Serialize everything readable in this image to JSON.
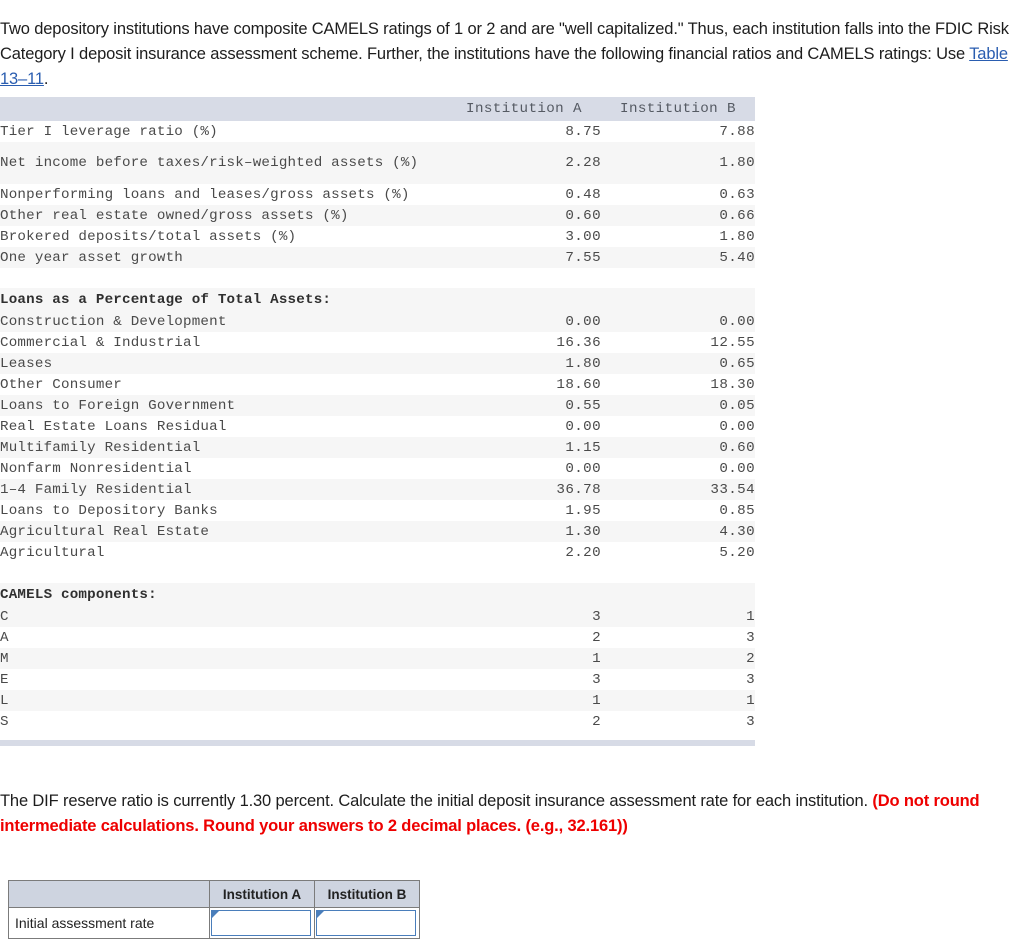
{
  "intro": {
    "part1": "Two depository institutions have composite CAMELS ratings of 1 or 2 and are \"well capitalized.\" Thus, each institution falls into the FDIC Risk Category I deposit insurance assessment scheme. Further, the institutions have the following financial ratios and CAMELS ratings: Use ",
    "link_text": "Table 13–11",
    "part2": "."
  },
  "table": {
    "headers": [
      "",
      "Institution A",
      "Institution B"
    ],
    "rows": [
      {
        "label": "Tier I leverage ratio (%)",
        "a": "8.75",
        "b": "7.88",
        "type": "row"
      },
      {
        "label": "Net income before taxes/risk–weighted assets (%)",
        "a": "2.28",
        "b": "1.80",
        "type": "row-tall"
      },
      {
        "label": "Nonperforming loans and leases/gross assets (%)",
        "a": "0.48",
        "b": "0.63",
        "type": "row"
      },
      {
        "label": "Other real estate owned/gross assets (%)",
        "a": "0.60",
        "b": "0.66",
        "type": "row"
      },
      {
        "label": "Brokered deposits/total assets (%)",
        "a": "3.00",
        "b": "1.80",
        "type": "row"
      },
      {
        "label": "One year asset growth",
        "a": "7.55",
        "b": "5.40",
        "type": "row"
      },
      {
        "label": "",
        "a": "",
        "b": "",
        "type": "spacer"
      },
      {
        "label": "Loans as a Percentage of Total Assets:",
        "a": "",
        "b": "",
        "type": "section"
      },
      {
        "label": "Construction & Development",
        "a": "0.00",
        "b": "0.00",
        "type": "row"
      },
      {
        "label": "Commercial & Industrial",
        "a": "16.36",
        "b": "12.55",
        "type": "row"
      },
      {
        "label": "Leases",
        "a": "1.80",
        "b": "0.65",
        "type": "row"
      },
      {
        "label": "Other Consumer",
        "a": "18.60",
        "b": "18.30",
        "type": "row"
      },
      {
        "label": "Loans to Foreign Government",
        "a": "0.55",
        "b": "0.05",
        "type": "row"
      },
      {
        "label": "Real Estate Loans Residual",
        "a": "0.00",
        "b": "0.00",
        "type": "row"
      },
      {
        "label": "Multifamily Residential",
        "a": "1.15",
        "b": "0.60",
        "type": "row"
      },
      {
        "label": "Nonfarm Nonresidential",
        "a": "0.00",
        "b": "0.00",
        "type": "row"
      },
      {
        "label": "1–4 Family Residential",
        "a": "36.78",
        "b": "33.54",
        "type": "row"
      },
      {
        "label": "Loans to Depository Banks",
        "a": "1.95",
        "b": "0.85",
        "type": "row"
      },
      {
        "label": "Agricultural Real Estate",
        "a": "1.30",
        "b": "4.30",
        "type": "row"
      },
      {
        "label": "Agricultural",
        "a": "2.20",
        "b": "5.20",
        "type": "row"
      },
      {
        "label": "",
        "a": "",
        "b": "",
        "type": "spacer"
      },
      {
        "label": "CAMELS components:",
        "a": "",
        "b": "",
        "type": "section"
      },
      {
        "label": "C",
        "a": "3",
        "b": "1",
        "type": "row"
      },
      {
        "label": "A",
        "a": "2",
        "b": "3",
        "type": "row"
      },
      {
        "label": "M",
        "a": "1",
        "b": "2",
        "type": "row"
      },
      {
        "label": "E",
        "a": "3",
        "b": "3",
        "type": "row"
      },
      {
        "label": "L",
        "a": "1",
        "b": "1",
        "type": "row"
      },
      {
        "label": "S",
        "a": "2",
        "b": "3",
        "type": "row"
      }
    ]
  },
  "prompt": {
    "part1": "The DIF reserve ratio is currently 1.30 percent. Calculate the initial deposit insurance assessment rate for each institution. ",
    "warning": "(Do not round intermediate calculations. Round your answers to 2 decimal places. (e.g., 32.161))"
  },
  "answer_table": {
    "blank_header": "",
    "headers": [
      "Institution A",
      "Institution B"
    ],
    "row_label": "Initial assessment rate",
    "values": [
      "",
      ""
    ]
  },
  "colors": {
    "header_bg": "#d7dbe6",
    "stripe": "#f6f6f6",
    "link": "#2a5db0",
    "warning": "#ee0000",
    "input_border": "#4a7ebb"
  }
}
